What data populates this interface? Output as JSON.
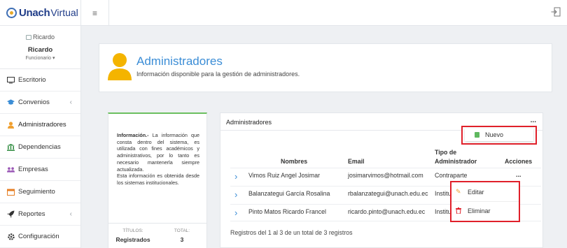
{
  "brand": {
    "bold": "Unach",
    "light": "Virtual"
  },
  "user": {
    "avatar_alt": "Ricardo",
    "name": "Ricardo",
    "role": "Funcionario ▾"
  },
  "sidebar": {
    "items": [
      {
        "label": "Escritorio",
        "icon": "monitor-icon"
      },
      {
        "label": "Convenios",
        "icon": "graduation-cap-icon",
        "chevron": "‹"
      },
      {
        "label": "Administradores",
        "icon": "user-icon"
      },
      {
        "label": "Dependencias",
        "icon": "building-icon"
      },
      {
        "label": "Empresas",
        "icon": "users-icon"
      },
      {
        "label": "Seguimiento",
        "icon": "calendar-icon"
      },
      {
        "label": "Reportes",
        "icon": "rocket-icon",
        "chevron": "‹"
      },
      {
        "label": "Configuración",
        "icon": "gear-icon"
      }
    ]
  },
  "topbar": {
    "menu_glyph": "≡"
  },
  "header": {
    "title": "Administradores",
    "subtitle": "Información disponible para la gestión de administradores."
  },
  "info": {
    "bold": "Información.-",
    "text": " La información que consta dentro del sistema, es utilizada con fines académicos y administrativos, por lo tanto es necesario mantenerla siempre actualizada.",
    "text2": "Esta información es obtenida desde los sistemas institucionales.",
    "titles_label": "TÍTULOS:",
    "titles_value": "Registrados",
    "total_label": "TOTAL:",
    "total_value": "3"
  },
  "table": {
    "title": "Administradores",
    "menu_dots": "...",
    "headers": {
      "nombres": "Nombres",
      "email": "Email",
      "tipo1": "Tipo de",
      "tipo2": "Administrador",
      "acciones": "Acciones"
    },
    "rows": [
      {
        "arrow": "›",
        "name": "Vimos Ruiz Angel Josimar",
        "email": "josimarvimos@hotmail.com",
        "tipo": "Contraparte",
        "actions": "..."
      },
      {
        "arrow": "›",
        "name": "Balanzategui García Rosalina",
        "email": "rbalanzategui@unach.edu.ec",
        "tipo": "Instituci"
      },
      {
        "arrow": "›",
        "name": "Pinto Matos Ricardo Francel",
        "email": "ricardo.pinto@unach.edu.ec",
        "tipo": "Instituci"
      }
    ],
    "footer": "Registros del 1 al 3 de un total de 3 registros"
  },
  "dropdown_nuevo": {
    "label": "Nuevo",
    "icon": "file-icon",
    "icon_color": "#5fb85f"
  },
  "dropdown_actions": [
    {
      "label": "Editar",
      "icon": "edit-icon",
      "glyph": "✎",
      "color": "#f0a030"
    },
    {
      "label": "Eliminar",
      "icon": "trash-icon",
      "glyph": "🗑",
      "color": "#e0202a"
    }
  ],
  "colors": {
    "accent": "#3b8dd6",
    "person": "#f4b400",
    "highlight": "#e0202a",
    "info_border": "#6bbf5f"
  }
}
